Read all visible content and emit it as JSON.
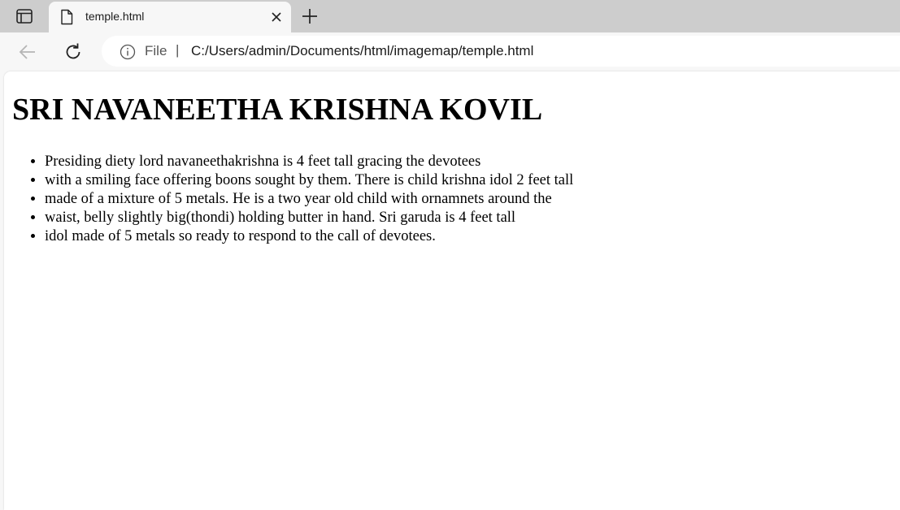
{
  "browser": {
    "tab": {
      "title": "temple.html"
    },
    "address_bar": {
      "scheme_label": "File",
      "separator": "|",
      "url": "C:/Users/admin/Documents/html/imagemap/temple.html"
    }
  },
  "page": {
    "heading": "SRI NAVANEETHA KRISHNA KOVIL",
    "list_items": [
      "Presiding diety lord navaneethakrishna is 4 feet tall gracing the devotees",
      "with a smiling face offering boons sought by them. There is child krishna idol 2 feet tall",
      "made of a mixture of 5 metals. He is a two year old child with ornamnets around the",
      "waist, belly slightly big(thondi) holding butter in hand. Sri garuda is 4 feet tall",
      "idol made of 5 metals so ready to respond to the call of devotees."
    ]
  },
  "icons": {
    "tab_actions": "tab-actions-icon",
    "document": "document-icon",
    "close": "close-icon",
    "new_tab": "plus-icon",
    "back": "back-arrow-icon",
    "reload": "reload-icon",
    "info": "info-icon"
  }
}
